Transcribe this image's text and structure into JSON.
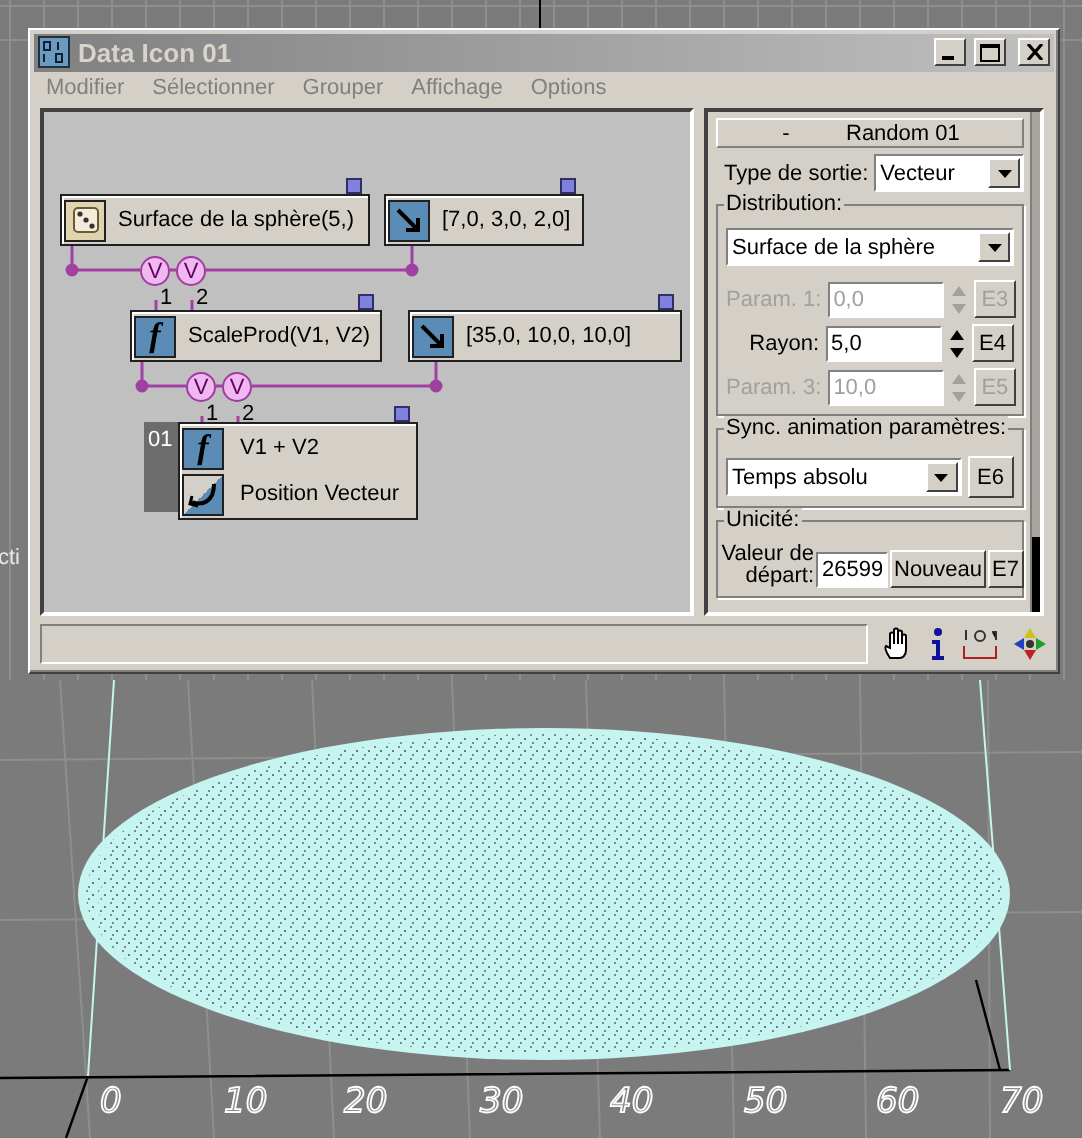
{
  "window": {
    "title": "Data Icon 01"
  },
  "menu": [
    "Modifier",
    "Sélectionner",
    "Grouper",
    "Affichage",
    "Options"
  ],
  "graph": {
    "nodes": [
      {
        "kind": "random",
        "label": "Surface de la sphère(5,)"
      },
      {
        "kind": "vector",
        "label": "[7,0, 3,0, 2,0]"
      },
      {
        "kind": "function",
        "symbol": "f",
        "label": "ScaleProd(V1, V2)"
      },
      {
        "kind": "vector",
        "label": "[35,0, 10,0, 10,0]"
      },
      {
        "kind": "output",
        "badge": "01",
        "rows": [
          {
            "kind": "function",
            "symbol": "f",
            "label": "V1 + V2"
          },
          {
            "kind": "position",
            "label": "Position Vecteur"
          }
        ]
      }
    ],
    "joiners": [
      {
        "symbol": "V",
        "port": "1"
      },
      {
        "symbol": "V",
        "port": "2"
      },
      {
        "symbol": "V",
        "port": "1"
      },
      {
        "symbol": "V",
        "port": "2"
      }
    ]
  },
  "rollout": {
    "collapse": "-",
    "title": "Random 01",
    "output_type": {
      "label": "Type de sortie:",
      "value": "Vecteur"
    },
    "distribution": {
      "title": "Distribution:",
      "value": "Surface de la sphère",
      "params": [
        {
          "label": "Param. 1:",
          "value": "0,0",
          "button": "E3",
          "disabled": true
        },
        {
          "label": "Rayon:",
          "value": "5,0",
          "button": "E4",
          "disabled": false
        },
        {
          "label": "Param. 3:",
          "value": "10,0",
          "button": "E5",
          "disabled": true
        }
      ]
    },
    "sync": {
      "title": "Sync. animation paramètres:",
      "value": "Temps absolu",
      "button": "E6"
    },
    "uniqueness": {
      "title": "Unicité:",
      "label": "Valeur de départ:",
      "value": "26599",
      "new_button": "Nouveau",
      "button": "E7"
    }
  },
  "viewport": {
    "side_text": "cti",
    "axis_labels": [
      "0",
      "10",
      "20",
      "30",
      "40",
      "50",
      "60",
      "70"
    ]
  }
}
